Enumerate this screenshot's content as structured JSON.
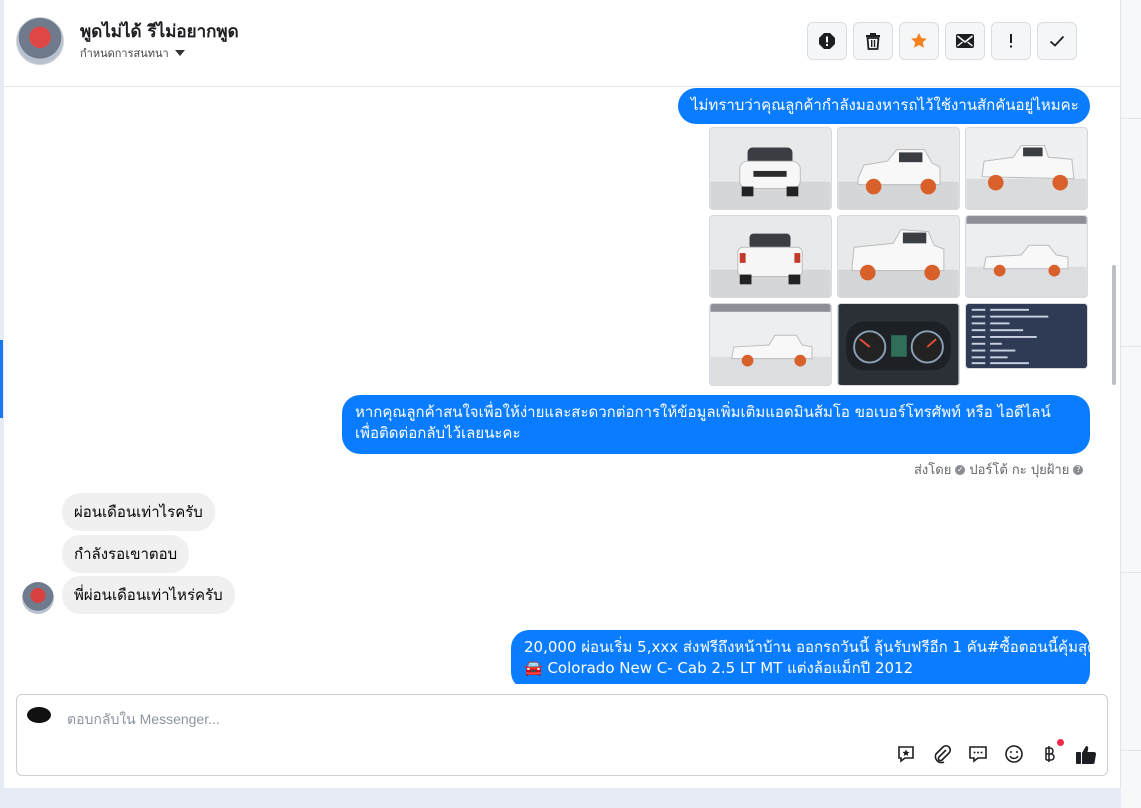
{
  "header": {
    "contact_name": "พูดไม่ได้ รีไม่อยากพูด",
    "status": "กำหนดการสนทนา",
    "toolbar": [
      {
        "name": "report-icon",
        "label": ""
      },
      {
        "name": "trash-icon",
        "label": ""
      },
      {
        "name": "star-icon",
        "label": ""
      },
      {
        "name": "mail-icon",
        "label": ""
      },
      {
        "name": "exclamation-icon",
        "label": ""
      },
      {
        "name": "check-icon",
        "label": ""
      }
    ]
  },
  "messages": {
    "outgoing_1": "ไม่ทราบว่าคุณลูกค้ากำลังมองหารถไว้ใช้งานสักคันอยู่ไหมคะ",
    "outgoing_2_line1": "หากคุณลูกค้าสนใจเพื่อให้ง่ายและสะดวกต่อการให้ข้อมูลเพิ่มเติมแอดมินส้มโอ ขอเบอร์โทรศัพท์ หรือ ไอดีไลน์",
    "outgoing_2_line2": "เพื่อติดต่อกลับไว้เลยนะคะ",
    "sent_by_label": "ส่งโดย",
    "sent_by_name": "ปอร์โต้ กะ ปุยฝ้าย",
    "incoming": [
      "ผ่อนเดือนเท่าไรครับ",
      "กำลังรอเขาตอบ",
      "พี่ผ่อนเดือนเท่าไหร่ครับ"
    ],
    "outgoing_3_line1": "20,000 ผ่อนเริ่ม 5,xxx ส่งฟรีถึงหน้าบ้าน ออกรถวันนี้ ลุ้นรับฟรีอีก 1 คัน#ซื้อตอนนี้คุ้มสุด",
    "outgoing_3_line2": "🚘 Colorado New C- Cab 2.5 LT MT แต่งล้อแม็กปี 2012"
  },
  "gallery": {
    "photos": [
      "car-front",
      "car-front-angle",
      "car-rear-angle",
      "car-rear",
      "car-rear-angle-2",
      "car-side",
      "car-side-2",
      "dashboard",
      "spec-sheet"
    ]
  },
  "composer": {
    "placeholder": "ตอบกลับใน Messenger...",
    "icons": [
      "saved-reply-icon",
      "attachment-icon",
      "chat-bubble-icon",
      "emoji-icon",
      "baht-payment-icon",
      "thumbs-up-icon"
    ]
  },
  "colors": {
    "outgoing_bubble": "#0a7cff",
    "incoming_bubble": "#f0f0f0",
    "star": "#f5821f",
    "notification_dot": "#f02849"
  }
}
